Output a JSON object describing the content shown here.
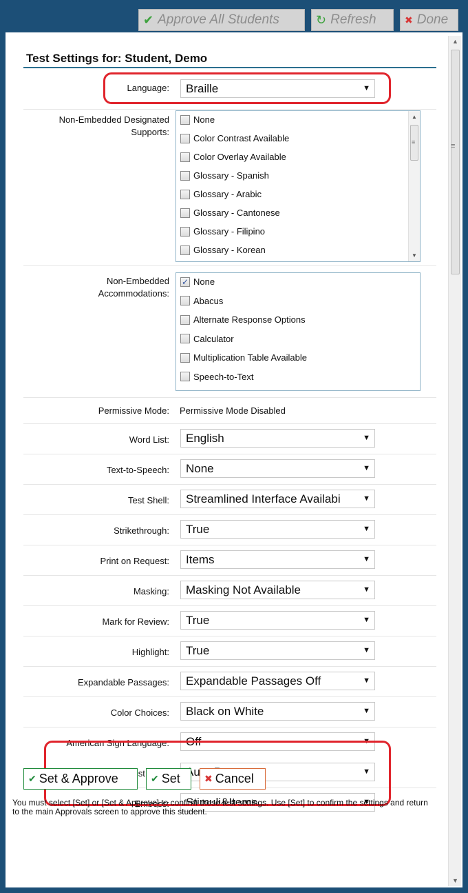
{
  "toolbar": {
    "approve_all": "Approve All Students",
    "refresh": "Refresh",
    "done": "Done"
  },
  "form": {
    "title": "Test Settings for: Student, Demo",
    "language": {
      "label": "Language:",
      "value": "Braille"
    },
    "designated_supports": {
      "label_line1": "Non-Embedded Designated",
      "label_line2": "Supports:",
      "options": [
        {
          "label": "None",
          "checked": false
        },
        {
          "label": "Color Contrast Available",
          "checked": false
        },
        {
          "label": "Color Overlay Available",
          "checked": false
        },
        {
          "label": "Glossary - Spanish",
          "checked": false
        },
        {
          "label": "Glossary - Arabic",
          "checked": false
        },
        {
          "label": "Glossary - Cantonese",
          "checked": false
        },
        {
          "label": "Glossary - Filipino",
          "checked": false
        },
        {
          "label": "Glossary - Korean",
          "checked": false
        }
      ]
    },
    "accommodations": {
      "label_line1": "Non-Embedded",
      "label_line2": "Accommodations:",
      "options": [
        {
          "label": "None",
          "checked": true
        },
        {
          "label": "Abacus",
          "checked": false
        },
        {
          "label": "Alternate Response Options",
          "checked": false
        },
        {
          "label": "Calculator",
          "checked": false
        },
        {
          "label": "Multiplication Table Available",
          "checked": false
        },
        {
          "label": "Speech-to-Text",
          "checked": false
        }
      ]
    },
    "permissive_mode": {
      "label": "Permissive Mode:",
      "value": "Permissive Mode Disabled"
    },
    "selects": [
      {
        "label": "Word List:",
        "value": "English"
      },
      {
        "label": "Text-to-Speech:",
        "value": "None"
      },
      {
        "label": "Test Shell:",
        "value": "Streamlined Interface Availabi"
      },
      {
        "label": "Strikethrough:",
        "value": "True"
      },
      {
        "label": "Print on Request:",
        "value": "Items"
      },
      {
        "label": "Masking:",
        "value": "Masking Not Available"
      },
      {
        "label": "Mark for Review:",
        "value": "True"
      },
      {
        "label": "Highlight:",
        "value": "True"
      },
      {
        "label": "Expandable Passages:",
        "value": "Expandable Passages Off"
      },
      {
        "label": "Color Choices:",
        "value": "Black on White"
      },
      {
        "label": "American Sign Language:",
        "value": "Off"
      },
      {
        "label": "Emboss Request Type:",
        "value": "Auto-Request"
      },
      {
        "label": "Emboss:",
        "value": "Stimuli&Items"
      }
    ]
  },
  "actions": {
    "set_approve": "Set & Approve",
    "set": "Set",
    "cancel": "Cancel"
  },
  "note": "You must select [Set] or [Set & Approve] to confirm these test settings. Use [Set] to confirm the settings and return to the main Approvals screen to approve this student.",
  "colors": {
    "frame": "#1c4f77",
    "highlight_ring": "#e0242c",
    "check_green": "#1f8a3a"
  }
}
